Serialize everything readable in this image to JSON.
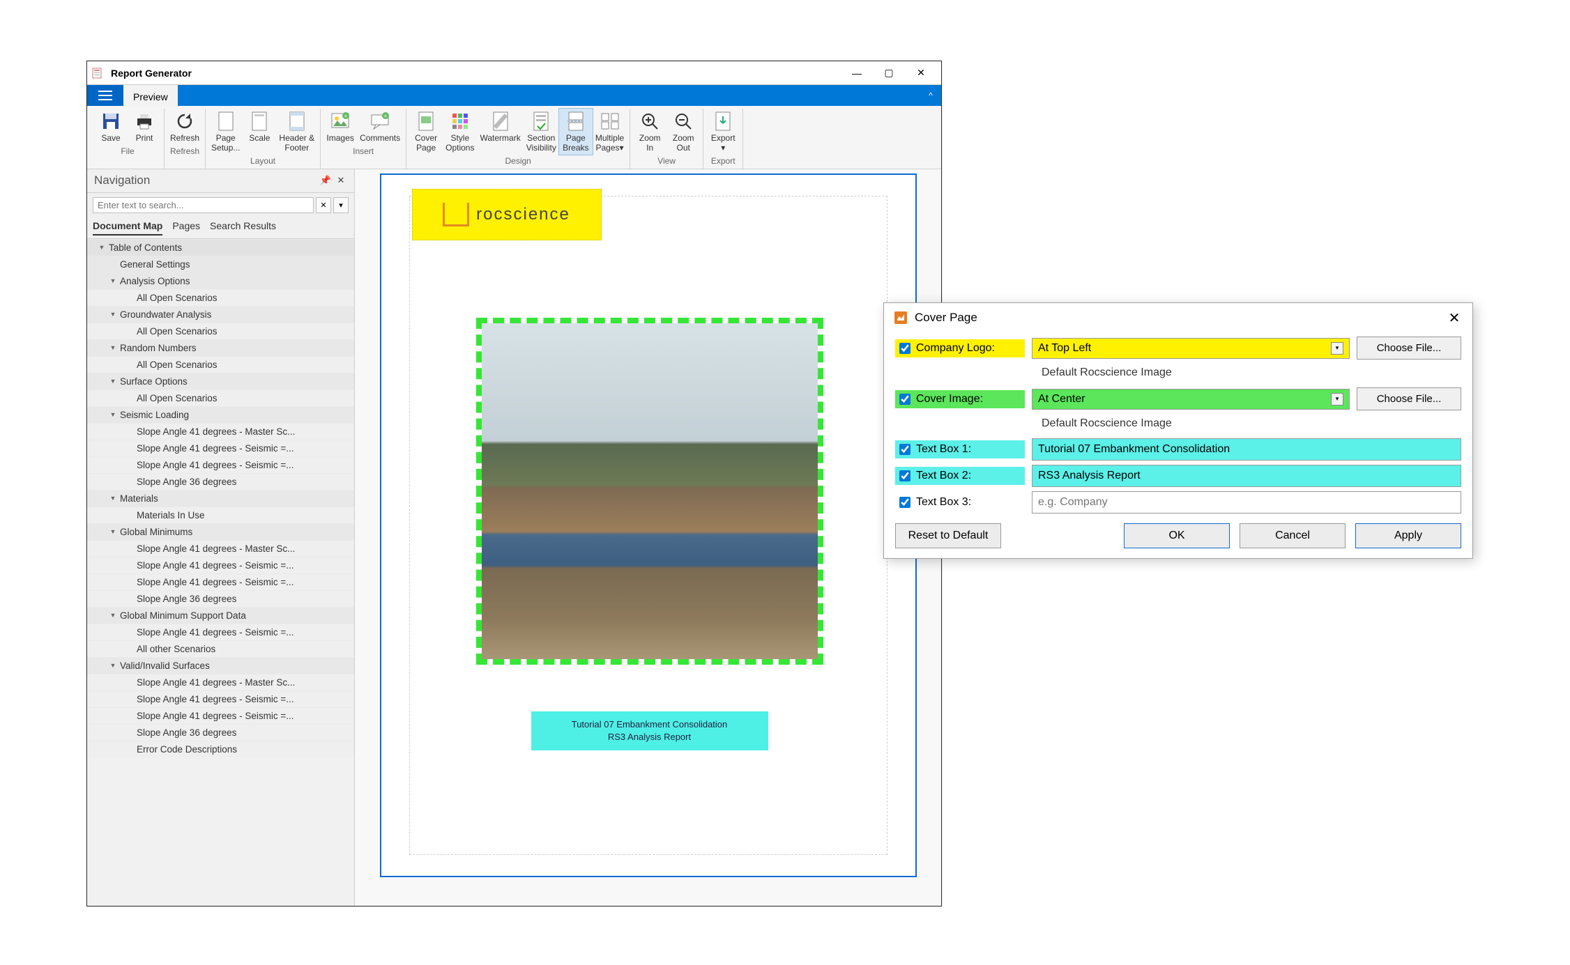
{
  "window": {
    "title": "Report Generator",
    "min": "—",
    "max": "▢",
    "close": "✕",
    "tab": "Preview"
  },
  "ribbon": [
    {
      "label": "File",
      "items": [
        {
          "id": "save",
          "label": "Save"
        },
        {
          "id": "print",
          "label": "Print"
        }
      ]
    },
    {
      "label": "Refresh",
      "items": [
        {
          "id": "refresh",
          "label": "Refresh"
        }
      ]
    },
    {
      "label": "Layout",
      "items": [
        {
          "id": "page-setup",
          "label": "Page\nSetup..."
        },
        {
          "id": "scale",
          "label": "Scale"
        },
        {
          "id": "header-footer",
          "label": "Header &\nFooter"
        }
      ]
    },
    {
      "label": "Insert",
      "items": [
        {
          "id": "images",
          "label": "Images"
        },
        {
          "id": "comments",
          "label": "Comments"
        }
      ]
    },
    {
      "label": "Design",
      "items": [
        {
          "id": "cover-page",
          "label": "Cover\nPage"
        },
        {
          "id": "style-options",
          "label": "Style\nOptions"
        },
        {
          "id": "watermark",
          "label": "Watermark"
        },
        {
          "id": "section-visibility",
          "label": "Section\nVisibility"
        },
        {
          "id": "page-breaks",
          "label": "Page\nBreaks",
          "selected": true
        },
        {
          "id": "multiple-pages",
          "label": "Multiple\nPages▾"
        }
      ]
    },
    {
      "label": "View",
      "items": [
        {
          "id": "zoom-in",
          "label": "Zoom\nIn"
        },
        {
          "id": "zoom-out",
          "label": "Zoom\nOut"
        }
      ]
    },
    {
      "label": "Export",
      "items": [
        {
          "id": "export",
          "label": "Export\n▾"
        }
      ]
    }
  ],
  "nav": {
    "title": "Navigation",
    "search_placeholder": "Enter text to search...",
    "tabs": [
      "Document Map",
      "Pages",
      "Search Results"
    ],
    "tree": [
      {
        "lvl": 0,
        "exp": "▼",
        "label": "Table of Contents"
      },
      {
        "lvl": 1,
        "exp": "",
        "label": "General Settings"
      },
      {
        "lvl": 1,
        "exp": "▼",
        "label": "Analysis Options"
      },
      {
        "lvl": 2,
        "exp": "",
        "label": "All Open Scenarios"
      },
      {
        "lvl": 1,
        "exp": "▼",
        "label": "Groundwater Analysis"
      },
      {
        "lvl": 2,
        "exp": "",
        "label": "All Open Scenarios"
      },
      {
        "lvl": 1,
        "exp": "▼",
        "label": "Random Numbers"
      },
      {
        "lvl": 2,
        "exp": "",
        "label": "All Open Scenarios"
      },
      {
        "lvl": 1,
        "exp": "▼",
        "label": "Surface Options"
      },
      {
        "lvl": 2,
        "exp": "",
        "label": "All Open Scenarios"
      },
      {
        "lvl": 1,
        "exp": "▼",
        "label": "Seismic Loading"
      },
      {
        "lvl": 2,
        "exp": "",
        "label": "Slope Angle 41 degrees - Master Sc..."
      },
      {
        "lvl": 2,
        "exp": "",
        "label": "Slope Angle 41 degrees - Seismic =..."
      },
      {
        "lvl": 2,
        "exp": "",
        "label": "Slope Angle 41 degrees - Seismic =..."
      },
      {
        "lvl": 2,
        "exp": "",
        "label": "Slope Angle 36 degrees"
      },
      {
        "lvl": 1,
        "exp": "▼",
        "label": "Materials"
      },
      {
        "lvl": 2,
        "exp": "",
        "label": "Materials In Use"
      },
      {
        "lvl": 1,
        "exp": "▼",
        "label": "Global Minimums"
      },
      {
        "lvl": 2,
        "exp": "",
        "label": "Slope Angle 41 degrees - Master Sc..."
      },
      {
        "lvl": 2,
        "exp": "",
        "label": "Slope Angle 41 degrees - Seismic =..."
      },
      {
        "lvl": 2,
        "exp": "",
        "label": "Slope Angle 41 degrees - Seismic =..."
      },
      {
        "lvl": 2,
        "exp": "",
        "label": "Slope Angle 36 degrees"
      },
      {
        "lvl": 1,
        "exp": "▼",
        "label": "Global Minimum Support Data"
      },
      {
        "lvl": 2,
        "exp": "",
        "label": "Slope Angle 41 degrees - Seismic =..."
      },
      {
        "lvl": 2,
        "exp": "",
        "label": "All other Scenarios"
      },
      {
        "lvl": 1,
        "exp": "▼",
        "label": "Valid/Invalid Surfaces"
      },
      {
        "lvl": 2,
        "exp": "",
        "label": "Slope Angle 41 degrees - Master Sc..."
      },
      {
        "lvl": 2,
        "exp": "",
        "label": "Slope Angle 41 degrees - Seismic =..."
      },
      {
        "lvl": 2,
        "exp": "",
        "label": "Slope Angle 41 degrees - Seismic =..."
      },
      {
        "lvl": 2,
        "exp": "",
        "label": "Slope Angle 36 degrees"
      },
      {
        "lvl": 2,
        "exp": "",
        "label": "Error Code Descriptions"
      }
    ]
  },
  "page": {
    "logo_text": "rocscience",
    "text1": "Tutorial 07 Embankment Consolidation",
    "text2": "RS3 Analysis Report"
  },
  "dialog": {
    "title": "Cover Page",
    "rows": {
      "logo_label": "Company Logo:",
      "logo_value": "At Top Left",
      "logo_btn": "Choose File...",
      "logo_note": "Default Rocscience Image",
      "image_label": "Cover Image:",
      "image_value": "At Center",
      "image_btn": "Choose File...",
      "image_note": "Default Rocscience Image",
      "t1_label": "Text Box 1:",
      "t1_value": "Tutorial 07 Embankment Consolidation",
      "t2_label": "Text Box 2:",
      "t2_value": "RS3 Analysis Report",
      "t3_label": "Text Box 3:",
      "t3_placeholder": "e.g. Company"
    },
    "footer": {
      "reset": "Reset to Default",
      "ok": "OK",
      "cancel": "Cancel",
      "apply": "Apply"
    }
  }
}
